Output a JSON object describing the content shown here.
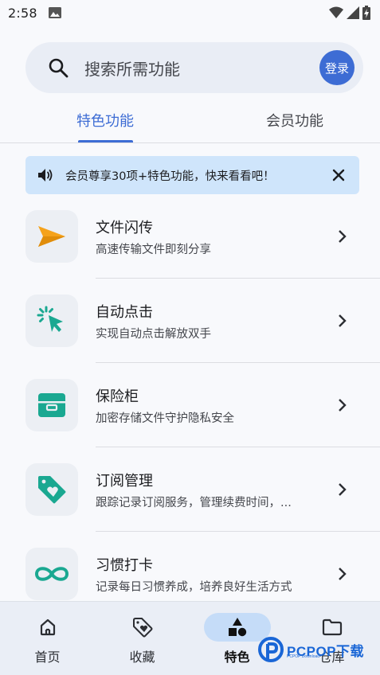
{
  "status_bar": {
    "time": "2:58"
  },
  "search": {
    "placeholder": "搜索所需功能",
    "login_label": "登录"
  },
  "tabs": [
    {
      "label": "特色功能",
      "selected": true
    },
    {
      "label": "会员功能",
      "selected": false
    }
  ],
  "banner": {
    "text": "会员尊享30项+特色功能，快来看看吧！"
  },
  "features": [
    {
      "title": "文件闪传",
      "subtitle": "高速传输文件即刻分享",
      "icon": "send-icon",
      "color": "#f5a21b"
    },
    {
      "title": "自动点击",
      "subtitle": "实现自动点击解放双手",
      "icon": "auto-click-icon",
      "color": "#1aa891"
    },
    {
      "title": "保险柜",
      "subtitle": "加密存储文件守护隐私安全",
      "icon": "safe-box-icon",
      "color": "#1aa891"
    },
    {
      "title": "订阅管理",
      "subtitle": "跟踪记录订阅服务，管理续费时间，...",
      "icon": "tag-heart-icon",
      "color": "#1aa891"
    },
    {
      "title": "习惯打卡",
      "subtitle": "记录每日习惯养成，培养良好生活方式",
      "icon": "infinity-icon",
      "color": "#1aa891"
    }
  ],
  "bottom_nav": [
    {
      "label": "首页",
      "icon": "home-icon",
      "active": false
    },
    {
      "label": "收藏",
      "icon": "tag-heart-icon",
      "active": false
    },
    {
      "label": "特色",
      "icon": "shapes-icon",
      "active": true
    },
    {
      "label": "仓库",
      "icon": "folder-icon",
      "active": false
    }
  ],
  "watermark": {
    "text": "PCPOP下载",
    "sub": "PCPOP Download"
  },
  "colors": {
    "accent": "#3d6cd4",
    "banner_bg": "#cfe5fb",
    "feature_teal": "#1aa891",
    "feature_orange": "#f5a21b"
  }
}
